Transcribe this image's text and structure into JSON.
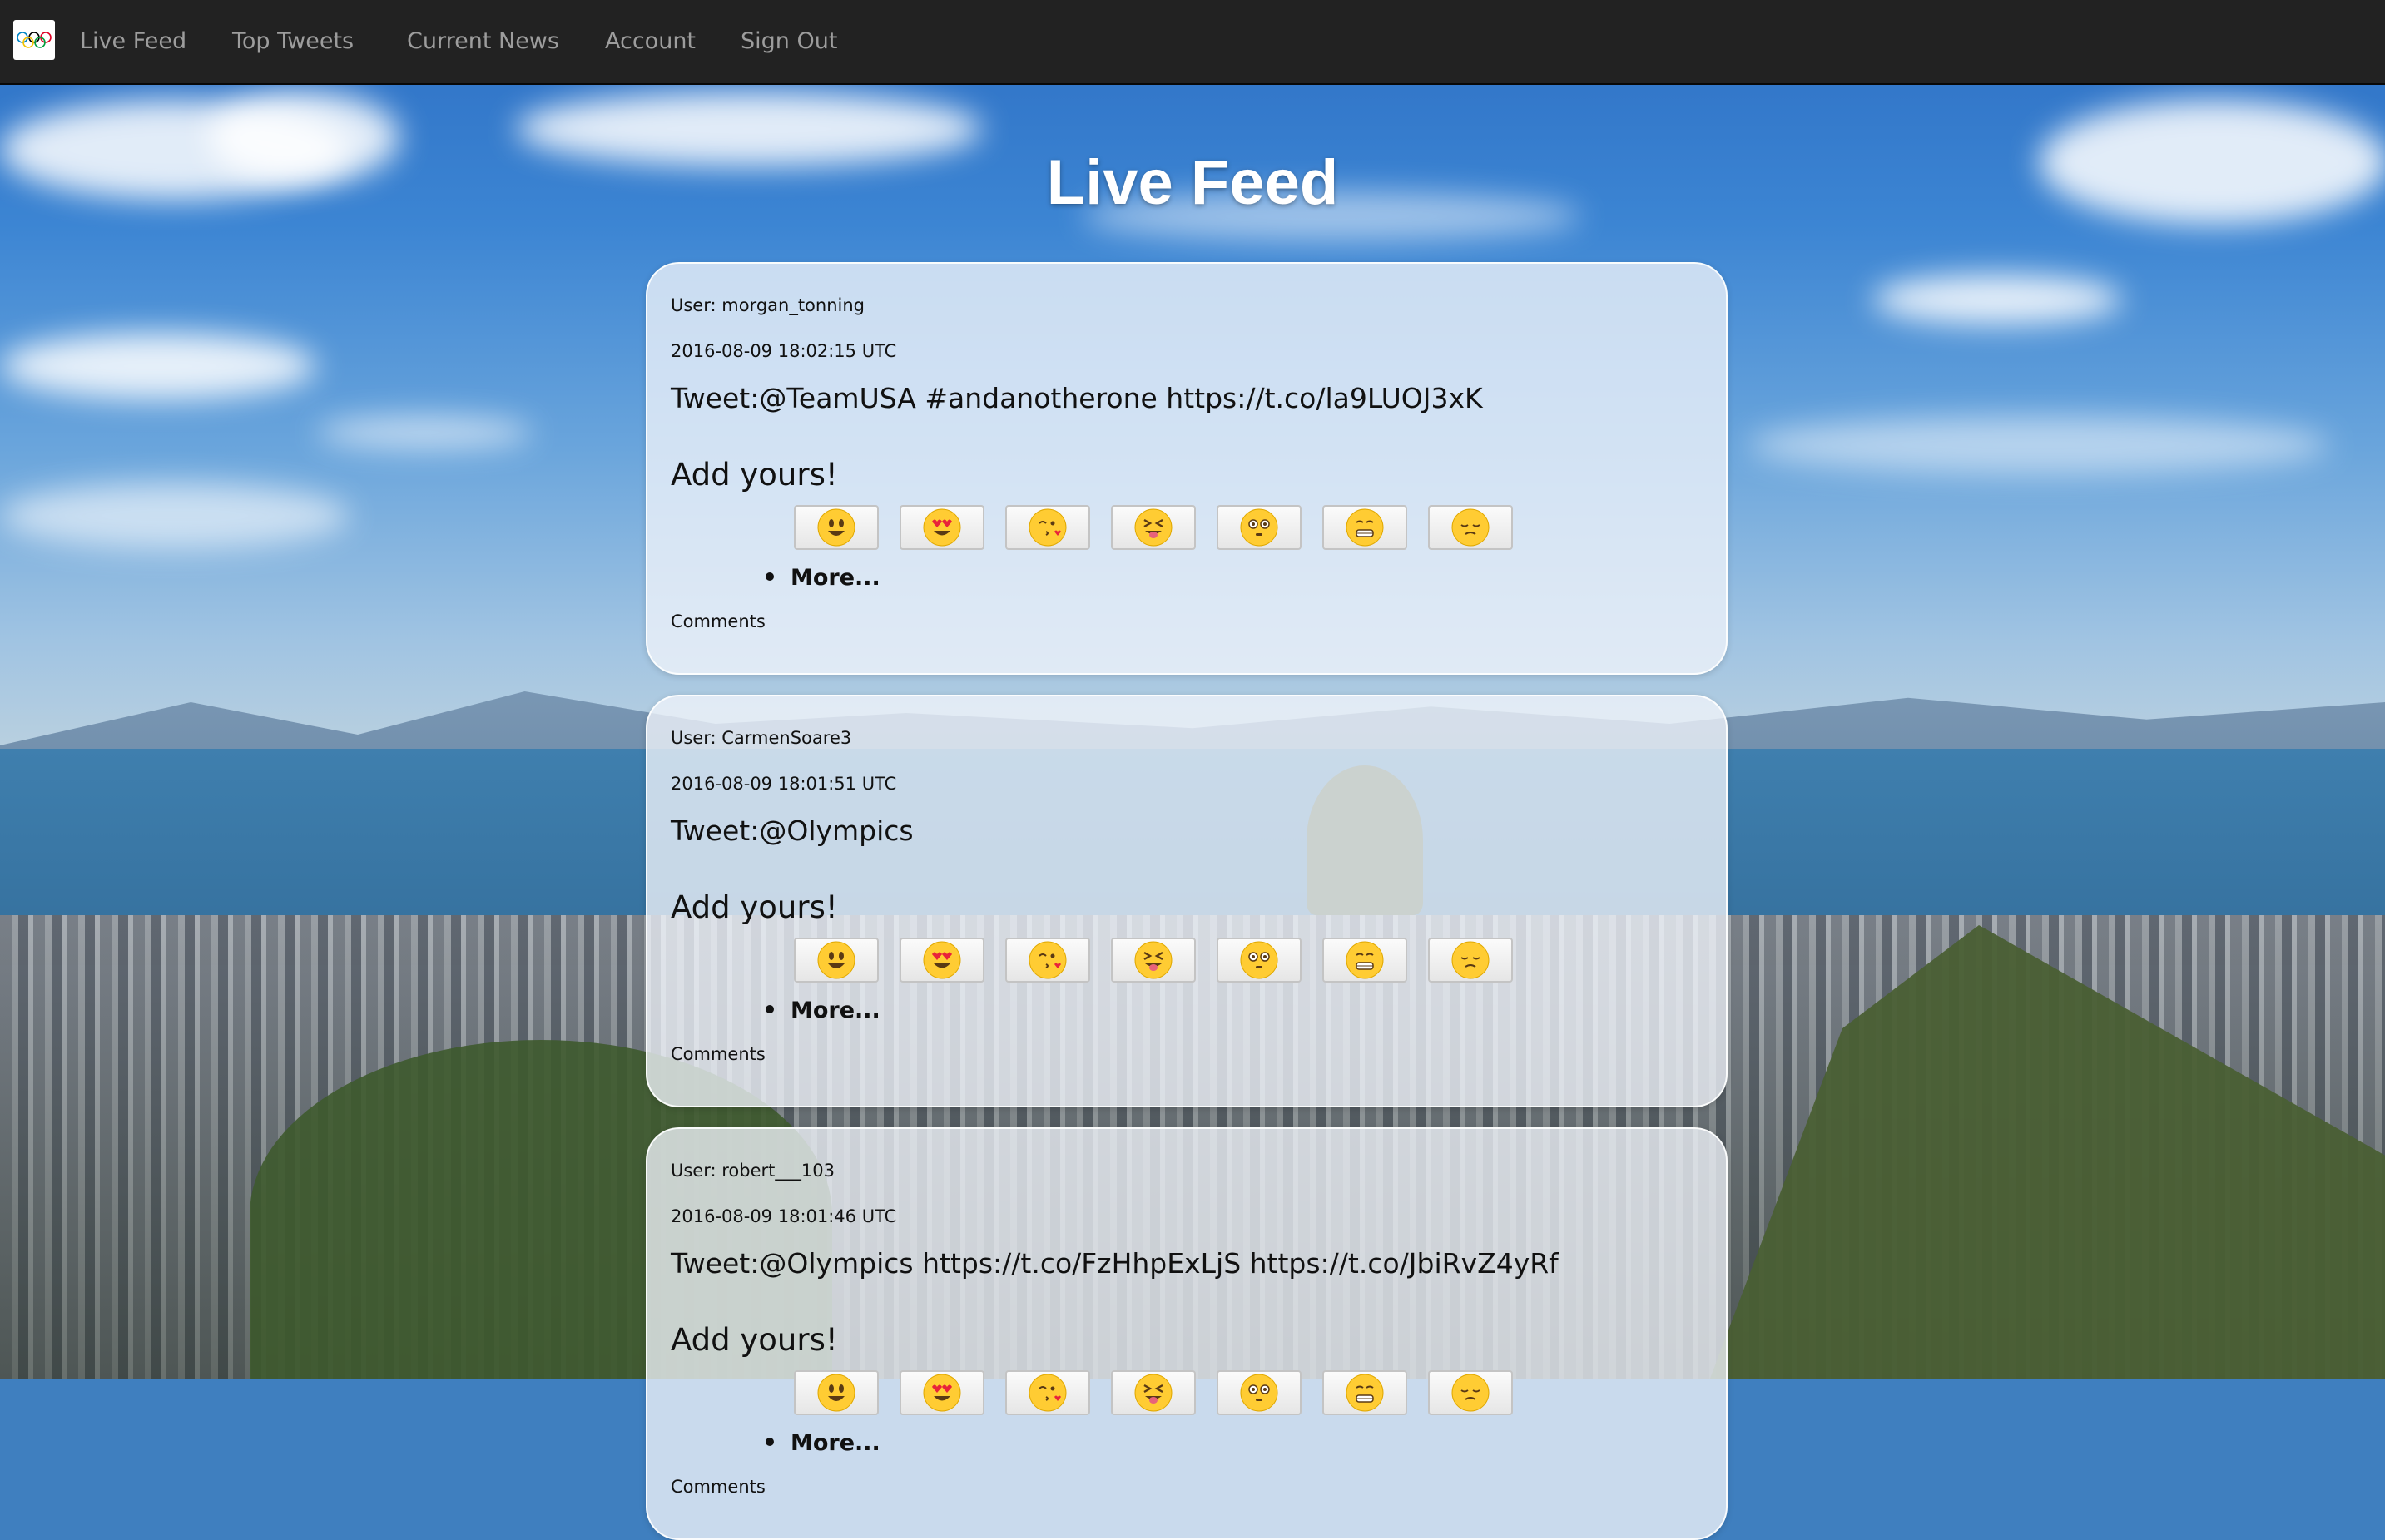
{
  "nav": {
    "logo_icon": "olympic-rings-icon",
    "items": [
      "Live Feed",
      "Top Tweets",
      "Current News",
      "Account",
      "Sign Out"
    ]
  },
  "page": {
    "title": "Live Feed"
  },
  "emojis": [
    "smiley",
    "heart-eyes",
    "kissing-heart",
    "squinting-tongue",
    "flushed",
    "grimacing",
    "pensive"
  ],
  "tweets": [
    {
      "user": "User: morgan_tonning",
      "date": "2016-08-09 18:02:15 UTC",
      "tweet": "Tweet:@TeamUSA #andanotherone https://t.co/la9LUOJ3xK",
      "add_label": "Add yours!",
      "more_label": "More...",
      "comments_label": "Comments"
    },
    {
      "user": "User: CarmenSoare3",
      "date": "2016-08-09 18:01:51 UTC",
      "tweet": "Tweet:@Olympics",
      "add_label": "Add yours!",
      "more_label": "More...",
      "comments_label": "Comments"
    },
    {
      "user": "User: robert___103",
      "date": "2016-08-09 18:01:46 UTC",
      "tweet": "Tweet:@Olympics https://t.co/FzHhpExLjS https://t.co/JbiRvZ4yRf",
      "add_label": "Add yours!",
      "more_label": "More...",
      "comments_label": "Comments"
    }
  ],
  "colors": {
    "navbar": "#222222",
    "nav_text": "#9d9d9d",
    "title": "#ffffff",
    "card": "#f0f4fa"
  }
}
